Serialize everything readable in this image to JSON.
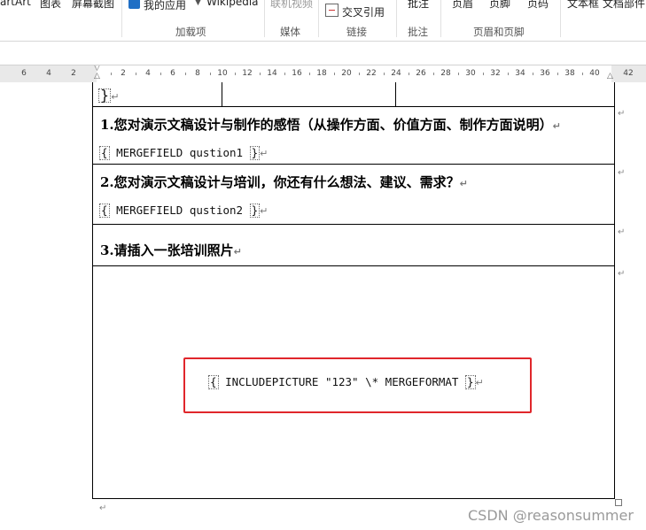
{
  "ribbon": {
    "items": {
      "smartart": "artArt",
      "chart": "图表",
      "screenshot": "屏幕截图",
      "my_apps": "我的应用",
      "wikipedia": "Wikipedia",
      "online_video": "联机视频",
      "cross_ref": "交叉引用",
      "comment": "批注",
      "header": "页眉",
      "footer": "页脚",
      "page_num": "页码",
      "textbox": "文本框",
      "doc_parts": "文档部件"
    },
    "groups": {
      "addins": "加载项",
      "media": "媒体",
      "links": "链接",
      "comments": "批注",
      "header_footer": "页眉和页脚"
    }
  },
  "ruler": {
    "labels": [
      "6",
      "4",
      "2",
      "2",
      "4",
      "6",
      "8",
      "10",
      "12",
      "14",
      "16",
      "18",
      "20",
      "22",
      "24",
      "26",
      "28",
      "30",
      "32",
      "34",
      "36",
      "38",
      "40",
      "42"
    ]
  },
  "document": {
    "q1": "1.您对演示文稿设计与制作的感悟（从操作方面、价值方面、制作方面说明）",
    "q1_field": "MERGEFIELD qustion1",
    "q2": "2.您对演示文稿设计与培训，你还有什么想法、建议、需求？",
    "q2_field": "MERGEFIELD qustion2",
    "q3": "3.请插入一张培训照片",
    "include_field": "INCLUDEPICTURE \"123\" \\* MERGEFORMAT",
    "para_mark": "↵",
    "brace_open": "{",
    "brace_close": "}"
  },
  "watermark": "CSDN @reasonsummer",
  "colors": {
    "highlight": "#e0262b",
    "ribbon_bg": "#ffffff",
    "ruler_margin": "#e9e9e9"
  }
}
